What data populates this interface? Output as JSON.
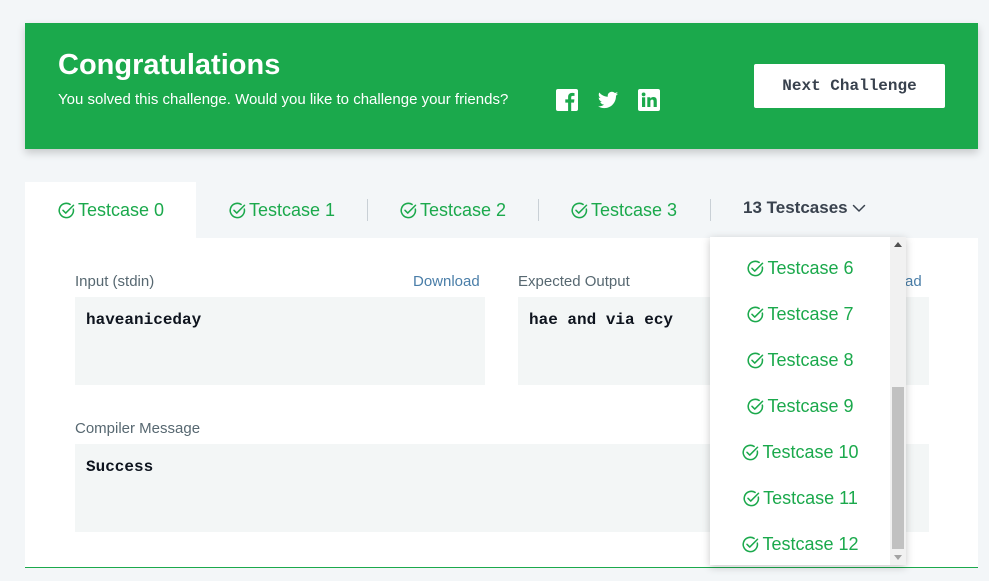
{
  "banner": {
    "title": "Congratulations",
    "subtitle": "You solved this challenge. Would you like to challenge your friends?",
    "next_button": "Next Challenge",
    "background_color": "#1ba94c",
    "social_icons": [
      "facebook-icon",
      "twitter-icon",
      "linkedin-icon"
    ]
  },
  "tabs": [
    {
      "label": "Testcase 0",
      "active": true
    },
    {
      "label": "Testcase 1",
      "active": false
    },
    {
      "label": "Testcase 2",
      "active": false
    },
    {
      "label": "Testcase 3",
      "active": false
    }
  ],
  "more_tabs_label": "13 Testcases",
  "input": {
    "label": "Input (stdin)",
    "download": "Download",
    "value": "haveaniceday"
  },
  "expected_output": {
    "label": "Expected Output",
    "download": "Download",
    "value": "hae and via ecy"
  },
  "compiler_message": {
    "label": "Compiler Message",
    "value": "Success"
  },
  "dropdown_items": [
    "Testcase 6",
    "Testcase 7",
    "Testcase 8",
    "Testcase 9",
    "Testcase 10",
    "Testcase 11",
    "Testcase 12"
  ],
  "colors": {
    "accent": "#1ba94c",
    "link": "#4a7ea8",
    "text": "#39424e"
  }
}
